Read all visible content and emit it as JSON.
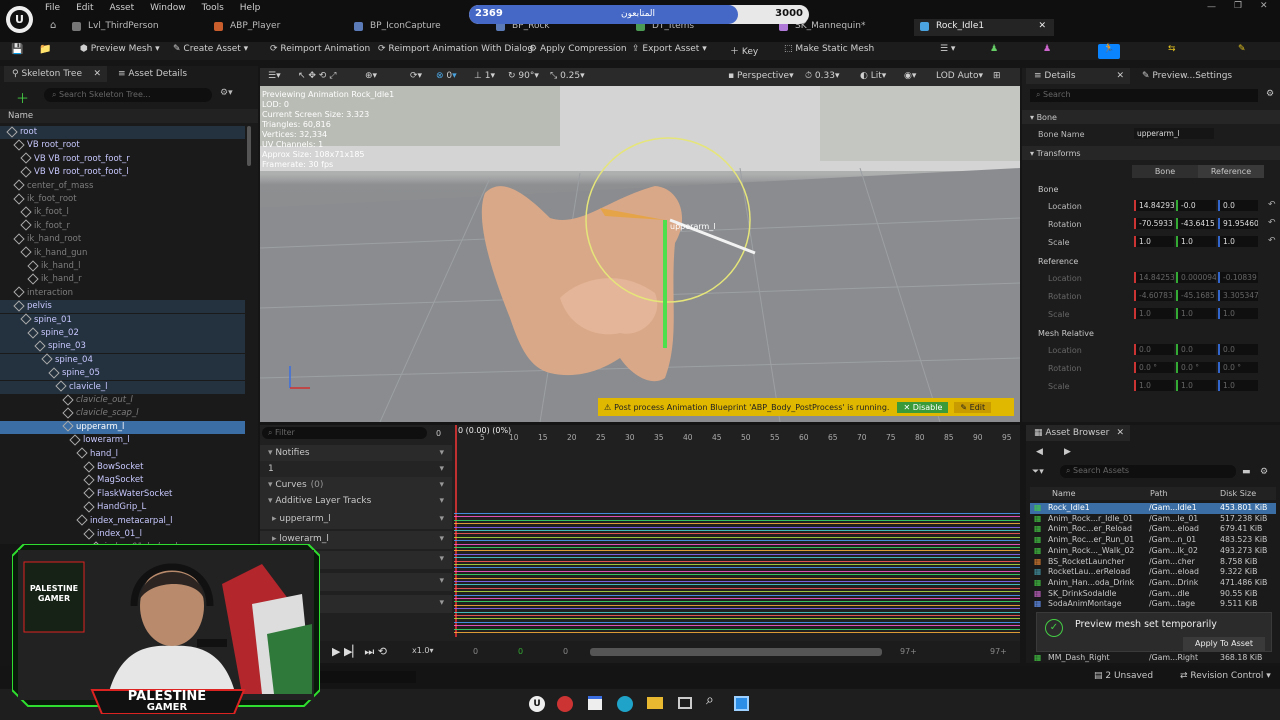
{
  "menu": [
    "File",
    "Edit",
    "Asset",
    "Window",
    "Tools",
    "Help"
  ],
  "tabs": [
    {
      "label": "Lvl_ThirdPerson"
    },
    {
      "label": "ABP_Player"
    },
    {
      "label": "BP_IconCapture"
    },
    {
      "label": "BP_Rock"
    },
    {
      "label": "DT_Items"
    },
    {
      "label": "SK_Mannequin*"
    },
    {
      "label": "Rock_Idle1",
      "active": true
    }
  ],
  "follower_bar": {
    "current": "2369",
    "label": "المتابعون",
    "goal": "3000",
    "progress": 0.79
  },
  "toolbar": {
    "preview_mesh": "Preview Mesh",
    "create_asset": "Create Asset",
    "reimport": "Reimport Animation",
    "reimport_dialog": "Reimport Animation With Dialog",
    "apply_compression": "Apply Compression",
    "export_asset": "Export Asset",
    "key": "Key",
    "make_static_mesh": "Make Static Mesh"
  },
  "skeleton_panel": {
    "tab1": "Skeleton Tree",
    "tab2": "Asset Details",
    "search_placeholder": "Search Skeleton Tree...",
    "column_name": "Name",
    "bones": [
      {
        "label": "root",
        "depth": 0,
        "style": "hl"
      },
      {
        "label": "VB root_root",
        "depth": 1
      },
      {
        "label": "VB VB root_root_foot_r",
        "depth": 2
      },
      {
        "label": "VB VB root_root_foot_l",
        "depth": 2
      },
      {
        "label": "center_of_mass",
        "depth": 1,
        "dim": true
      },
      {
        "label": "ik_foot_root",
        "depth": 1,
        "dim": true
      },
      {
        "label": "ik_foot_l",
        "depth": 2,
        "dim": true
      },
      {
        "label": "ik_foot_r",
        "depth": 2,
        "dim": true
      },
      {
        "label": "ik_hand_root",
        "depth": 1,
        "dim": true
      },
      {
        "label": "ik_hand_gun",
        "depth": 2,
        "dim": true
      },
      {
        "label": "ik_hand_l",
        "depth": 3,
        "dim": true
      },
      {
        "label": "ik_hand_r",
        "depth": 3,
        "dim": true
      },
      {
        "label": "interaction",
        "depth": 1,
        "dim": true
      },
      {
        "label": "pelvis",
        "depth": 1,
        "style": "hl"
      },
      {
        "label": "spine_01",
        "depth": 2,
        "style": "hl"
      },
      {
        "label": "spine_02",
        "depth": 3,
        "style": "hl"
      },
      {
        "label": "spine_03",
        "depth": 4,
        "style": "hl"
      },
      {
        "label": "spine_04",
        "depth": 5,
        "style": "hl"
      },
      {
        "label": "spine_05",
        "depth": 6,
        "style": "hl"
      },
      {
        "label": "clavicle_l",
        "depth": 7,
        "style": "hl"
      },
      {
        "label": "clavicle_out_l",
        "depth": 8,
        "dim": true,
        "italic": true
      },
      {
        "label": "clavicle_scap_l",
        "depth": 8,
        "dim": true,
        "italic": true
      },
      {
        "label": "upperarm_l",
        "depth": 8,
        "style": "sel"
      },
      {
        "label": "lowerarm_l",
        "depth": 9
      },
      {
        "label": "hand_l",
        "depth": 10
      },
      {
        "label": "BowSocket",
        "depth": 11
      },
      {
        "label": "MagSocket",
        "depth": 11
      },
      {
        "label": "FlaskWaterSocket",
        "depth": 11
      },
      {
        "label": "HandGrip_L",
        "depth": 11
      },
      {
        "label": "index_metacarpal_l",
        "depth": 10
      },
      {
        "label": "index_01_l",
        "depth": 11
      },
      {
        "label": "index_01_bulge_l",
        "depth": 12,
        "dim": true,
        "italic": true
      }
    ]
  },
  "viewport": {
    "perspective": "Perspective",
    "fov": "0.33",
    "lit": "Lit",
    "lod": "LOD Auto",
    "snap_grid": "0",
    "snap_rot": "90°",
    "snap_scale": "0.25",
    "cam_speed": "1",
    "info": [
      "Previewing Animation Rock_Idle1",
      "LOD: 0",
      "Current Screen Size: 3.323",
      "Triangles: 60,816",
      "Vertices: 32,334",
      "UV Channels: 1",
      "Approx Size: 108x71x185",
      "Framerate: 30 fps"
    ],
    "bone_label": "upperarm_l",
    "warning": "Post process Animation Blueprint 'ABP_Body_PostProcess' is running.",
    "disable": "Disable",
    "edit": "Edit"
  },
  "timeline": {
    "filter_placeholder": "Filter",
    "count": "0",
    "time": "0 (0.00) (0%)",
    "ticks": [
      "5",
      "10",
      "15",
      "20",
      "25",
      "30",
      "35",
      "40",
      "45",
      "50",
      "55",
      "60",
      "65",
      "70",
      "75",
      "80",
      "85",
      "90",
      "95"
    ],
    "tracks": [
      {
        "label": "Notifies"
      },
      {
        "label": "1"
      },
      {
        "label": "Curves",
        "extra": "(0)"
      },
      {
        "label": "Additive Layer Tracks"
      },
      {
        "label": "upperarm_l"
      },
      {
        "label": "lowerarm_l"
      },
      {
        "label": ""
      },
      {
        "label": "r"
      },
      {
        "label": "r"
      }
    ],
    "speed": "x1.0",
    "frame_a": "0",
    "frame_b": "0",
    "frame_c": "0",
    "end_a": "97+",
    "end_b": "97+"
  },
  "details": {
    "tab1": "Details",
    "tab2": "Preview...Settings",
    "search_placeholder": "Search",
    "section_bone": "Bone",
    "bone_name_label": "Bone Name",
    "bone_name_value": "upperarm_l",
    "section_transforms": "Transforms",
    "btn_bone": "Bone",
    "btn_reference": "Reference",
    "sub_bone": "Bone",
    "location": "Location",
    "rotation": "Rotation",
    "scale": "Scale",
    "bone_loc": [
      "14.84293",
      "-0.0",
      "0.0"
    ],
    "bone_rot": [
      "-70.5933",
      "-43.6415",
      "91.95460"
    ],
    "bone_scale": [
      "1.0",
      "1.0",
      "1.0"
    ],
    "sub_reference": "Reference",
    "ref_loc": [
      "14.84253",
      "0.000094",
      "-0.10839"
    ],
    "ref_rot": [
      "-4.60783",
      "-45.1685",
      "3.305347"
    ],
    "ref_scale": [
      "1.0",
      "1.0",
      "1.0"
    ],
    "sub_mesh_relative": "Mesh Relative",
    "mr_loc": [
      "0.0",
      "0.0",
      "0.0"
    ],
    "mr_rot": [
      "0.0 °",
      "0.0 °",
      "0.0 °"
    ],
    "mr_scale": [
      "1.0",
      "1.0",
      "1.0"
    ]
  },
  "asset_browser": {
    "tab": "Asset Browser",
    "search_placeholder": "Search Assets",
    "col_name": "Name",
    "col_path": "Path",
    "col_size": "Disk Size",
    "rows": [
      {
        "name": "Rock_Idle1",
        "path": "/Gam...Idle1",
        "size": "453.801 KiB",
        "sel": true
      },
      {
        "name": "Anim_Rock...r_Idle_01",
        "path": "/Gam...le_01",
        "size": "517.238 KiB"
      },
      {
        "name": "Anim_Roc...er_Reload",
        "path": "/Gam...eload",
        "size": "679.41 KiB"
      },
      {
        "name": "Anim_Roc...er_Run_01",
        "path": "/Gam...n_01",
        "size": "483.523 KiB"
      },
      {
        "name": "Anim_Rock..._Walk_02",
        "path": "/Gam...lk_02",
        "size": "493.273 KiB"
      },
      {
        "name": "BS_RocketLauncher",
        "path": "/Gam...cher",
        "size": "8.758 KiB"
      },
      {
        "name": "RocketLau...erReload",
        "path": "/Gam...eload",
        "size": "9.322 KiB"
      },
      {
        "name": "Anim_Han...oda_Drink",
        "path": "/Gam...Drink",
        "size": "471.486 KiB"
      },
      {
        "name": "SK_DrinkSodaIdle",
        "path": "/Gam...dle",
        "size": "90.55 KiB"
      },
      {
        "name": "SodaAnimMontage",
        "path": "/Gam...tage",
        "size": "9.511 KiB"
      }
    ],
    "last_row": {
      "name": "MM_Dash_Right",
      "path": "/Gam...Right",
      "size": "368.18 KiB"
    },
    "toast": "Preview mesh set temporarily",
    "apply": "Apply To Asset"
  },
  "status": {
    "unsaved": "2 Unsaved",
    "revision": "Revision Control"
  },
  "webcam": {
    "brand_top": "PALESTINE",
    "brand_sub": "GAMER",
    "badge_top": "PALESTINE",
    "badge_sub": "GAMER"
  }
}
